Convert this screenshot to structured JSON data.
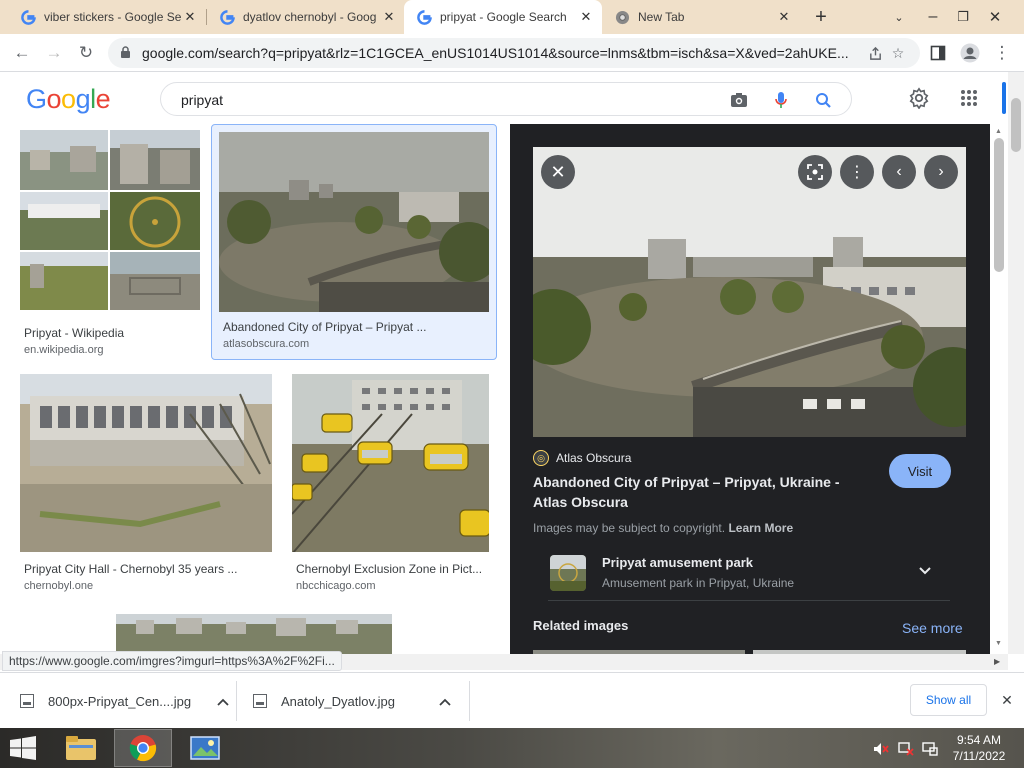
{
  "browser": {
    "tabs": [
      {
        "title": "viber stickers - Google Se",
        "favicon": "google-g-icon"
      },
      {
        "title": "dyatlov chernobyl - Goog",
        "favicon": "google-g-icon"
      },
      {
        "title": "pripyat - Google Search",
        "favicon": "google-g-icon",
        "active": true
      },
      {
        "title": "New Tab",
        "favicon": "chrome-icon"
      }
    ],
    "url": "google.com/search?q=pripyat&rlz=1C1GCEA_enUS1014US1014&source=lnms&tbm=isch&sa=X&ved=2ahUKE..."
  },
  "google": {
    "logo": "Google",
    "query": "pripyat"
  },
  "results": [
    {
      "caption": "Pripyat - Wikipedia",
      "source": "en.wikipedia.org"
    },
    {
      "caption": "Abandoned City of Pripyat – Pripyat ...",
      "source": "atlasobscura.com"
    },
    {
      "caption": "Pripyat City Hall - Chernobyl 35 years ...",
      "source": "chernobyl.one"
    },
    {
      "caption": "Chernobyl Exclusion Zone in Pict...",
      "source": "nbcchicago.com"
    }
  ],
  "preview": {
    "site": "Atlas Obscura",
    "title": "Abandoned City of Pripyat – Pripyat, Ukraine - Atlas Obscura",
    "visit_label": "Visit",
    "copyright_text": "Images may be subject to copyright.",
    "learn_more": "Learn More",
    "entity_name": "Pripyat amusement park",
    "entity_desc": "Amusement park in Pripyat, Ukraine",
    "related_label": "Related images",
    "see_more": "See more"
  },
  "status_url": "https://www.google.com/imgres?imgurl=https%3A%2F%2Fi...",
  "downloads": [
    {
      "name": "800px-Pripyat_Cen....jpg"
    },
    {
      "name": "Anatoly_Dyatlov.jpg"
    }
  ],
  "show_all": "Show all",
  "taskbar": {
    "time": "9:54 AM",
    "date": "7/11/2022"
  },
  "colors": {
    "google_blue": "#4285F4",
    "google_red": "#EA4335",
    "google_yellow": "#FBBC05",
    "google_green": "#34A853",
    "preview_bg": "#202124",
    "visit_bg": "#8ab4f8"
  }
}
